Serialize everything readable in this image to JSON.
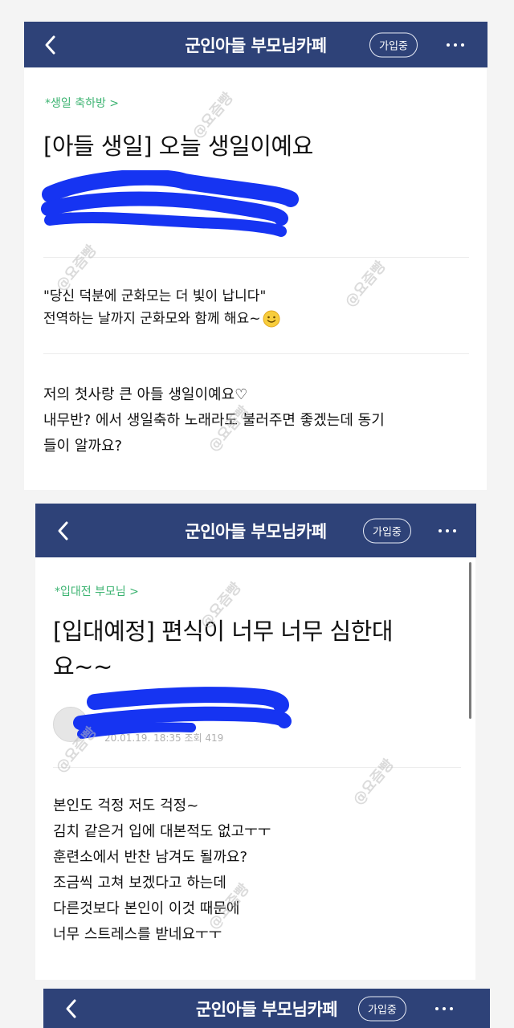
{
  "app": {
    "title": "군인아들 부모님카페",
    "joined_label": "가입중",
    "nav_color": "#2e4278"
  },
  "posts": [
    {
      "category": "*생일 축하방 >",
      "title": "[아들 생일] 오늘 생일이예요",
      "quote_lines": [
        "\"당신 덕분에 군화모는 더 빛이 납니다\"",
        "전역하는 날까지 군화모와 함께 해요~"
      ],
      "body_lines": [
        "저의 첫사랑 큰 아들 생일이예요♡",
        "내무반? 에서 생일축하 노래라도 불러주면 좋겠는데 동기",
        "들이 알까요?"
      ]
    },
    {
      "category": "*입대전 부모님 >",
      "title_lines": [
        "[입대예정] 편식이 너무 너무 심한대",
        "요~~"
      ],
      "meta": "20.01.19. 18:35 조회 419",
      "body_lines": [
        "본인도 걱정 저도 걱정~",
        "김치 같은거 입에 대본적도 없고ㅜㅜ",
        "훈련소에서 반찬 남겨도 될까요?",
        "조금씩 고쳐 보겠다고 하는데",
        "다른것보다 본인이 이것 때문에",
        "너무 스트레스를 받네요ㅜㅜ"
      ]
    }
  ],
  "watermark": "@요즘빵",
  "icons": {
    "back": "chevron-left-icon",
    "more": "more-dots-icon",
    "emoji": "smiley-emoji-icon"
  }
}
